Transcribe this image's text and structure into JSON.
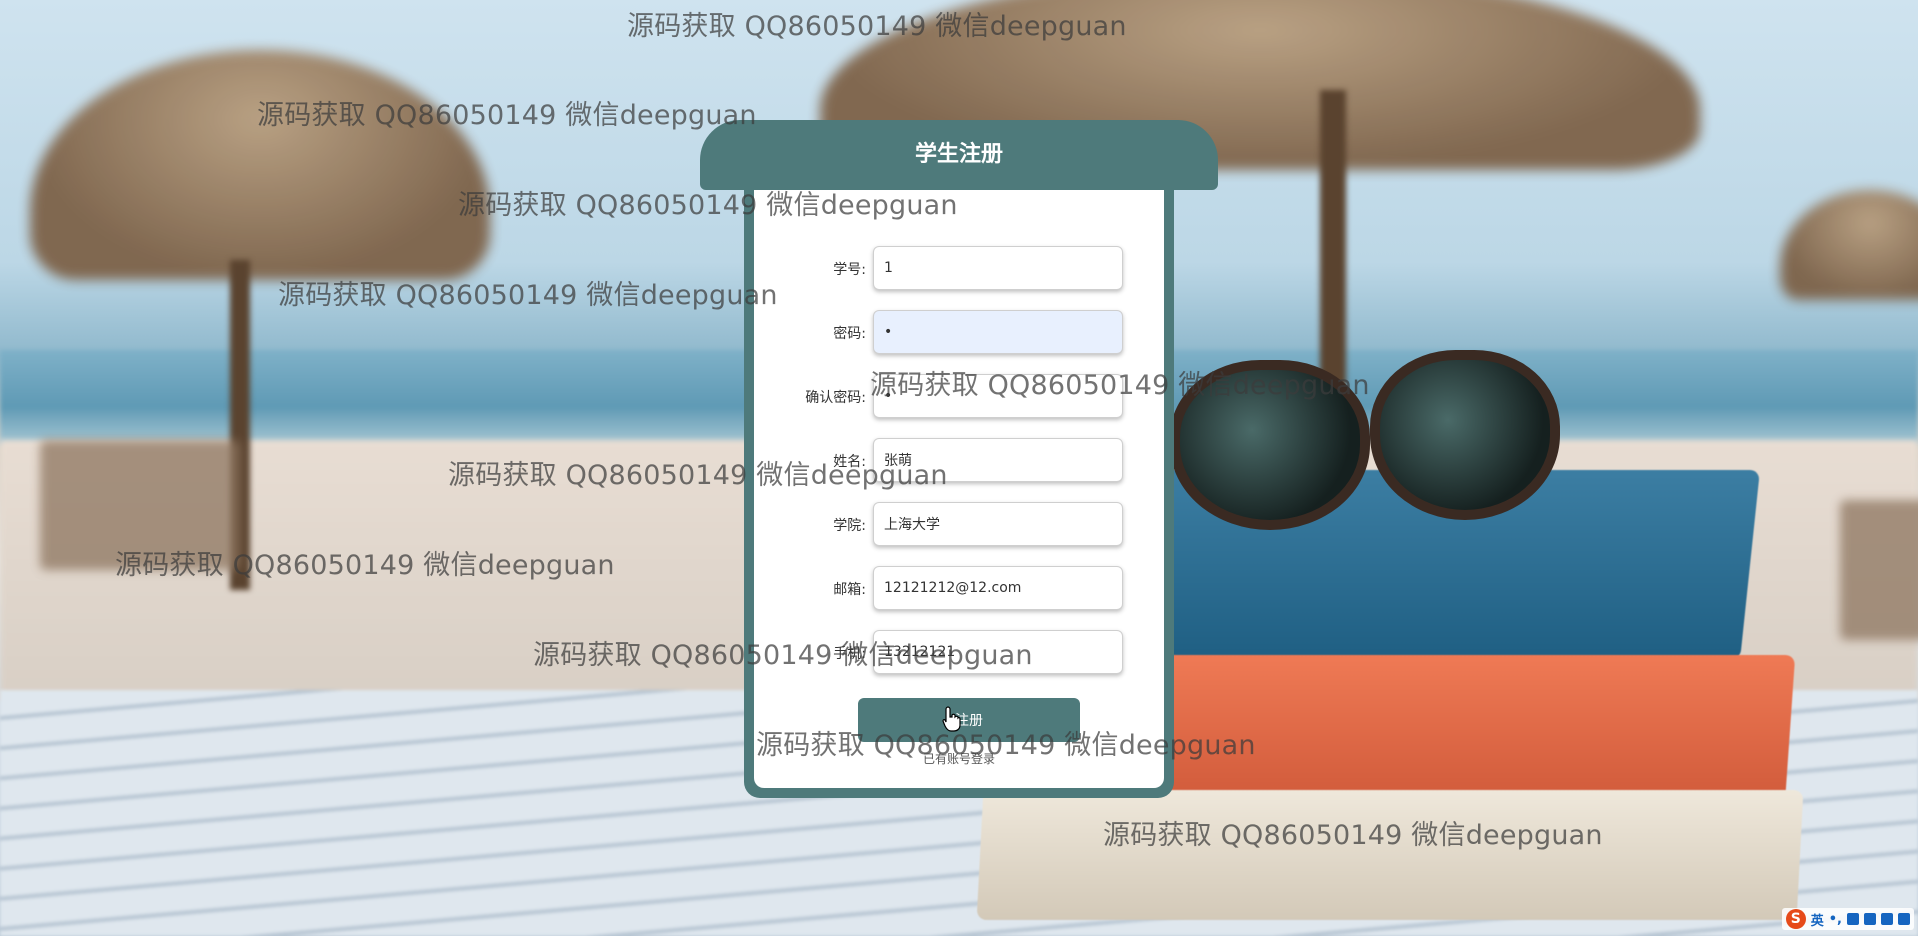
{
  "header": {
    "title": "学生注册"
  },
  "form": {
    "fields": [
      {
        "label": "学号:",
        "value": "1",
        "type": "text"
      },
      {
        "label": "密码:",
        "value": "•",
        "type": "password"
      },
      {
        "label": "确认密码:",
        "value": "•",
        "type": "password"
      },
      {
        "label": "姓名:",
        "value": "张萌",
        "type": "text"
      },
      {
        "label": "学院:",
        "value": "上海大学",
        "type": "text"
      },
      {
        "label": "邮箱:",
        "value": "12121212@12.com",
        "type": "text"
      },
      {
        "label": "手机:",
        "value": "13212121",
        "type": "text"
      }
    ],
    "submit_label": "注册",
    "login_link": "已有账号登录"
  },
  "watermark": "源码获取 QQ86050149 微信deepguan",
  "ime": {
    "lang": "英",
    "punct": "•,"
  },
  "colors": {
    "accent": "#4e7a7b",
    "input_focus": "#e8f0fe"
  }
}
